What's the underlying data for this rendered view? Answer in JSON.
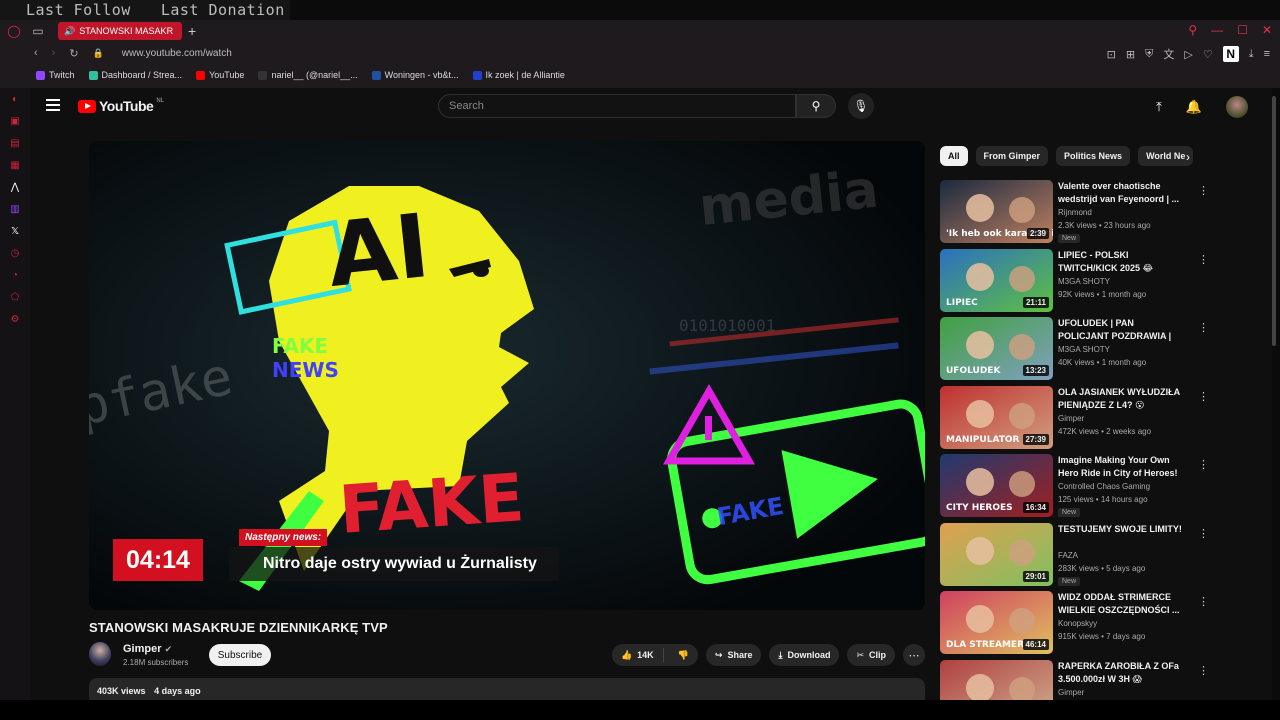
{
  "overlay": {
    "last_follow": "Last Follow",
    "last_donation": "Last Donation"
  },
  "browser": {
    "tab_title": "STANOWSKI MASAKR",
    "url": "www.youtube.com/watch",
    "bookmarks": [
      {
        "label": "Twitch",
        "color": "#9146ff"
      },
      {
        "label": "Dashboard / Strea...",
        "color": "#30c0a0"
      },
      {
        "label": "YouTube",
        "color": "#ff0000"
      },
      {
        "label": "nariel__ (@nariel__...",
        "color": "#333333"
      },
      {
        "label": "Woningen - vb&t...",
        "color": "#2050a0"
      },
      {
        "label": "Ik zoek | de Alliantie",
        "color": "#2040d0"
      }
    ]
  },
  "youtube": {
    "logo": "YouTube",
    "country": "NL",
    "search_placeholder": "Search"
  },
  "video": {
    "clock": "04:14",
    "banner_label": "Następny news:",
    "banner_text": "Nitro daje ostry wywiad u Żurnalisty",
    "art_ai": "AI",
    "art_fake": "FAKE",
    "art_fake_small": "FAKE",
    "art_news_small": "NEWS",
    "art_deepfake": "epfake",
    "art_media": "media",
    "art_binary": "0101010001",
    "title": "STANOWSKI MASAKRUJE DZIENNIKARKĘ TVP",
    "channel": "Gimper",
    "subscribers": "2.18M subscribers",
    "subscribe_label": "Subscribe",
    "likes": "14K",
    "share_label": "Share",
    "download_label": "Download",
    "clip_label": "Clip",
    "views": "403K views",
    "age": "4 days ago"
  },
  "chips": [
    "All",
    "From Gimper",
    "Politics News",
    "World Ne"
  ],
  "related": [
    {
      "title": "Valente over chaotische wedstrijd van Feyenoord | ...",
      "channel": "Rijnmond",
      "meta": "2.3K views • 23 hours ago",
      "duration": "2:39",
      "new": "New",
      "thumb_text": "'Ik heb ook karakter in mij'",
      "c1": "#1a2a40",
      "c2": "#c08060"
    },
    {
      "title": "LIPIEC - POLSKI TWITCH/KICK 2025 😂",
      "channel": "M3GA SHOTY",
      "meta": "92K views • 1 month ago",
      "duration": "21:11",
      "new": "",
      "thumb_text": "LIPIEC",
      "c1": "#2a70c0",
      "c2": "#60c040"
    },
    {
      "title": "UFOLUDEK | PAN POLICJANT POZDRAWIA | 😂 POLSKIE ...",
      "channel": "M3GA SHOTY",
      "meta": "40K views • 1 month ago",
      "duration": "13:23",
      "new": "",
      "thumb_text": "UFOLUDEK",
      "c1": "#40a040",
      "c2": "#80a0c0"
    },
    {
      "title": "OLA JASIANEK WYŁUDZIŁA PIENIĄDZE Z L4? 😮",
      "channel": "Gimper",
      "meta": "472K views • 2 weeks ago",
      "duration": "27:39",
      "new": "",
      "thumb_text": "MANIPULATOR",
      "c1": "#c03030",
      "c2": "#d0a080"
    },
    {
      "title": "Imagine Making Your Own Hero Ride in City of Heroes!",
      "channel": "Controlled Chaos Gaming",
      "meta": "125 views • 14 hours ago",
      "duration": "16:34",
      "new": "New",
      "thumb_text": "CITY HEROES",
      "c1": "#203a70",
      "c2": "#a02020"
    },
    {
      "title": "TESTUJEMY SWOJE LIMITY!",
      "channel": "FAZA",
      "meta": "283K views • 5 days ago",
      "duration": "29:01",
      "new": "New",
      "thumb_text": "",
      "c1": "#e0a050",
      "c2": "#80c060"
    },
    {
      "title": "WIDZ ODDAŁ STRIMERCE WIELKIE OSZCZĘDNOŚCI ...",
      "channel": "Konopskyy",
      "meta": "915K views • 7 days ago",
      "duration": "46:14",
      "new": "",
      "thumb_text": "DLA STREAMERKI",
      "c1": "#d04060",
      "c2": "#e0c060"
    },
    {
      "title": "RAPERKA ZAROBIŁA Z OFa 3.500.000zł W 3H 😱",
      "channel": "Gimper",
      "meta": "",
      "duration": "",
      "new": "",
      "thumb_text": "",
      "c1": "#b04040",
      "c2": "#d0b090"
    }
  ],
  "colors": {
    "accent": "#ff0000",
    "opera_red": "#d0203a",
    "art_yellow": "#f0f020",
    "art_green": "#40ff40",
    "art_cyan": "#30e0e0",
    "art_red": "#e02030",
    "art_magenta": "#e020e0"
  }
}
